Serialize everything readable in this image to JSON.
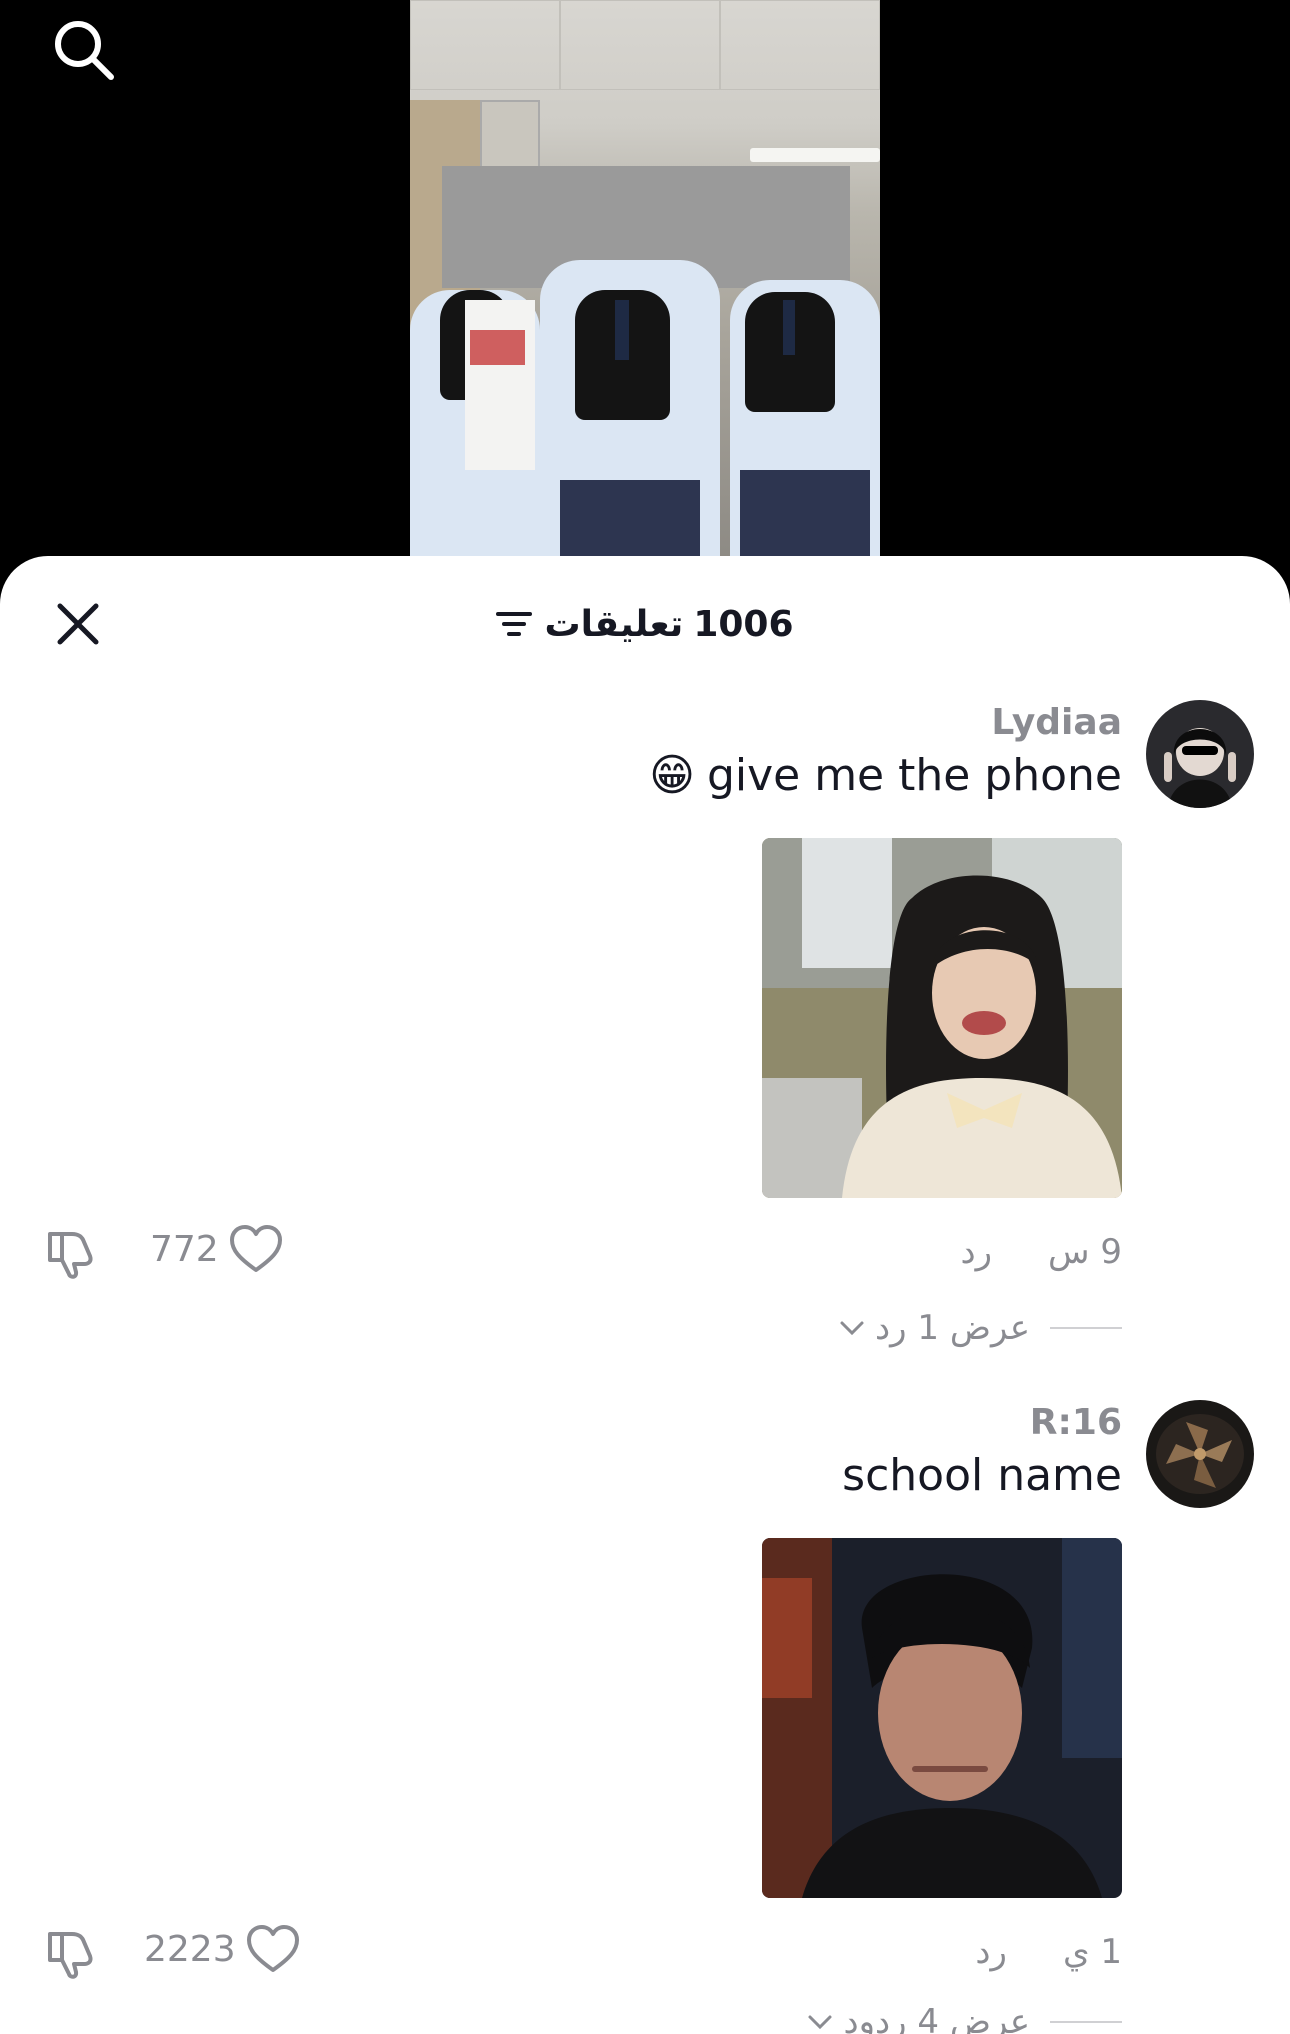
{
  "header": {
    "search_icon": "search-icon"
  },
  "sheet": {
    "count": "1006",
    "title_label": "تعليقات",
    "close_icon": "close-icon",
    "filter_icon": "filter-icon"
  },
  "comments": [
    {
      "username": "Lydiaa",
      "text": "give me the phone",
      "emoji": "😁",
      "time": "9 س",
      "reply_label": "رد",
      "likes": "772",
      "view_replies": "عرض 1 رد"
    },
    {
      "username": "R:16",
      "text": "school name",
      "time": "1 ي",
      "reply_label": "رد",
      "likes": "2223",
      "view_replies": "عرض 4 ردود"
    }
  ],
  "colors": {
    "text_primary": "#161823",
    "text_secondary": "#8a8b91",
    "background_top": "#000000",
    "sheet_background": "#ffffff"
  }
}
